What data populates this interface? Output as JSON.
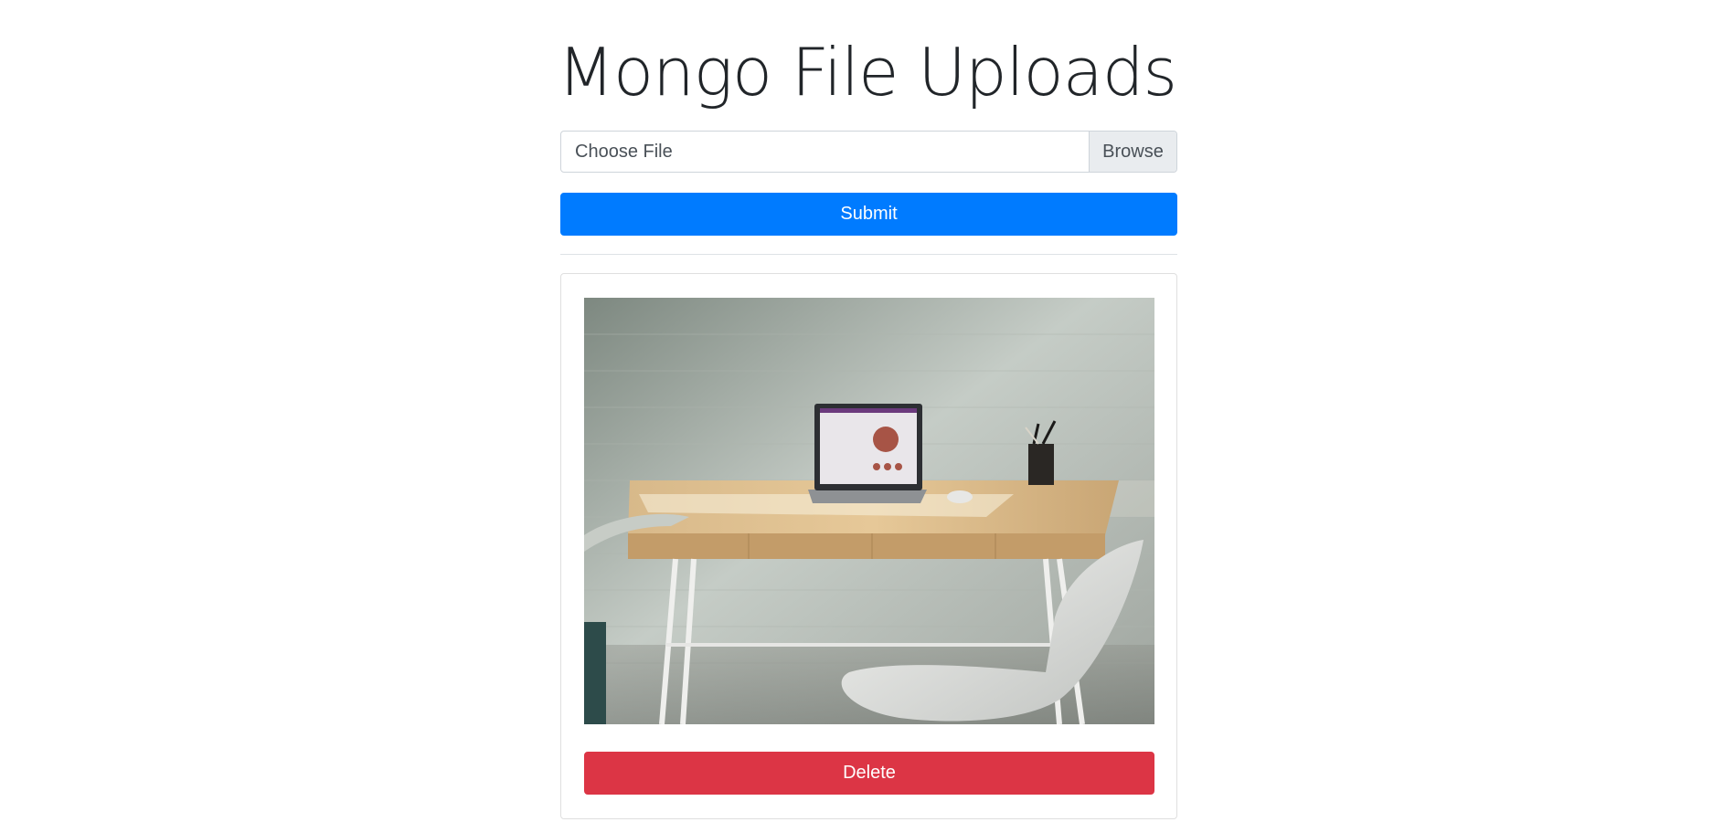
{
  "header": {
    "title": "Mongo File Uploads"
  },
  "upload_form": {
    "file_input_label": "Choose File",
    "browse_label": "Browse",
    "submit_label": "Submit"
  },
  "files": [
    {
      "image_subject": "wooden desk with laptop, pencil cup and white chair against a white brick wall",
      "delete_label": "Delete"
    }
  ],
  "colors": {
    "primary": "#007bff",
    "danger": "#dc3545",
    "text": "#212529",
    "border": "#ced4da",
    "addon_bg": "#e9ecef"
  }
}
